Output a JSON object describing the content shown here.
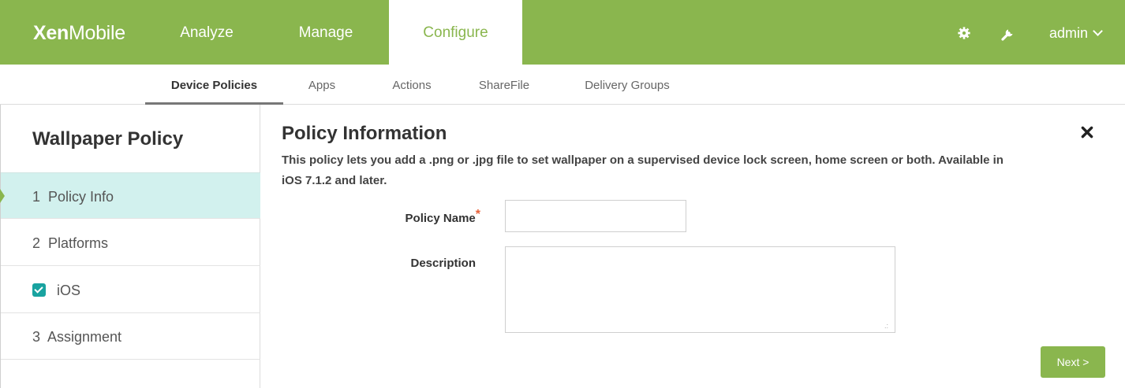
{
  "header": {
    "brand_bold": "Xen",
    "brand_light": "Mobile",
    "nav": [
      {
        "label": "Analyze"
      },
      {
        "label": "Manage"
      },
      {
        "label": "Configure"
      }
    ],
    "user": "admin",
    "icons": [
      "gear-icon",
      "wrench-icon",
      "chevron-down-icon"
    ],
    "accent_color": "#8ab64e"
  },
  "subnav": {
    "tabs": [
      {
        "label": "Device Policies"
      },
      {
        "label": "Apps"
      },
      {
        "label": "Actions"
      },
      {
        "label": "ShareFile"
      },
      {
        "label": "Delivery Groups"
      }
    ],
    "active": "Device Policies"
  },
  "sidebar": {
    "title": "Wallpaper Policy",
    "steps": [
      {
        "label": "1  Policy Info"
      },
      {
        "label": "2  Platforms"
      },
      {
        "label": "iOS",
        "checked": true
      },
      {
        "label": "3  Assignment"
      }
    ],
    "active_color": "#d2f1ee"
  },
  "main": {
    "heading": "Policy Information",
    "description": "This policy lets you add a .png or .jpg file to set wallpaper on a supervised device lock screen, home screen or both. Available in iOS 7.1.2 and later.",
    "policy_name_label": "Policy Name",
    "required_mark": "*",
    "policy_name_value": "",
    "description_label": "Description",
    "description_value": "",
    "next_label": "Next >"
  }
}
